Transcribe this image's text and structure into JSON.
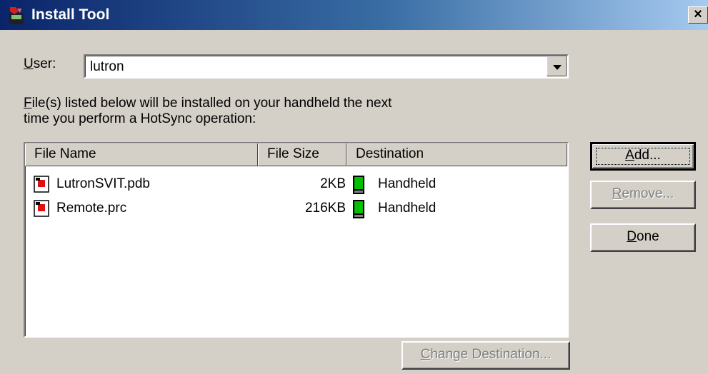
{
  "window": {
    "title": "Install Tool",
    "close_label": "×"
  },
  "user": {
    "label_accel": "U",
    "label_rest": "ser:",
    "value": "lutron"
  },
  "description": {
    "line1_accel": "F",
    "line1_rest": "ile(s) listed below will be installed on your handheld the next",
    "line2": "time you perform a HotSync operation:"
  },
  "table": {
    "columns": [
      "File Name",
      "File Size",
      "Destination"
    ],
    "rows": [
      {
        "name": "LutronSVIT.pdb",
        "size": "2KB",
        "destination": "Handheld"
      },
      {
        "name": "Remote.prc",
        "size": "216KB",
        "destination": "Handheld"
      }
    ]
  },
  "buttons": {
    "add": {
      "accel": "A",
      "rest": "dd..."
    },
    "remove": {
      "accel": "R",
      "rest": "emove..."
    },
    "done": {
      "accel": "D",
      "rest": "one"
    },
    "change_destination": {
      "accel": "C",
      "rest": "hange Destination..."
    }
  },
  "colors": {
    "title_start": "#0a246a",
    "title_end": "#a6caf0",
    "face": "#d4d0c8",
    "device_green": "#00c000"
  },
  "icons": {
    "app": "install-tool-app-icon",
    "file": "palm-file-icon",
    "device": "handheld-device-icon"
  }
}
